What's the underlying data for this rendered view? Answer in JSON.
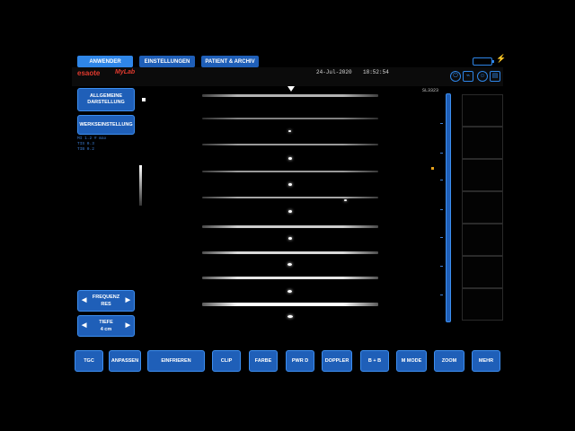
{
  "tabs": [
    {
      "label": "ANWENDER"
    },
    {
      "label": "EINSTELLUNGEN"
    },
    {
      "label": "PATIENT & ARCHIV"
    }
  ],
  "header": {
    "brand": "esaote",
    "product": "MyLab",
    "date": "24-Jul-2020",
    "time": "18:52:54"
  },
  "left_panel": {
    "general_display_line1": "ALLGEMEINE",
    "general_display_line2": "DARSTELLUNG",
    "factory_setting": "WERKSEINSTELLUNG",
    "info_lines": [
      "MI  1.2  # max",
      "TIS 0.3",
      "TIB 0.2"
    ],
    "frequency_label": "FREQUENZ",
    "frequency_value": "RES",
    "depth_label": "TIEFE",
    "depth_value": "4 cm"
  },
  "image": {
    "probe_label": "SL3323"
  },
  "bottom_buttons": [
    {
      "label": "TGC"
    },
    {
      "label": "ANPASSEN"
    },
    {
      "label": "EINFRIEREN"
    },
    {
      "label": "CLIP"
    },
    {
      "label": "FARBE"
    },
    {
      "label": "PWR D"
    },
    {
      "label": "DOPPLER"
    },
    {
      "label": "B + B"
    },
    {
      "label": "M MODE"
    },
    {
      "label": "ZOOM"
    },
    {
      "label": "MEHR"
    }
  ],
  "colors": {
    "accent": "#1f5fb8",
    "accent_light": "#3d8ef0",
    "brand_red": "#e23a2e",
    "focus": "#e8a31c"
  }
}
